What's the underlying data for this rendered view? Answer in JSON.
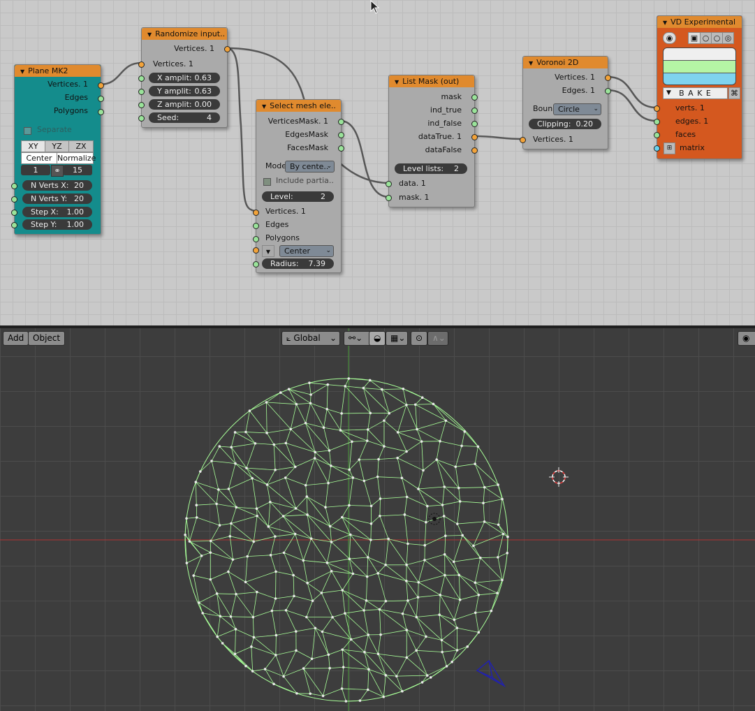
{
  "nodes": {
    "plane": {
      "title": "Plane MK2",
      "outputs": [
        "Vertices. 1",
        "Edges",
        "Polygons"
      ],
      "separate": "Separate",
      "planes": [
        "XY",
        "YZ",
        "ZX"
      ],
      "center": "Center",
      "normalize": "Normalize",
      "num_left": "1",
      "num_right": "15",
      "fields": [
        {
          "label": "N Verts X:",
          "value": "20"
        },
        {
          "label": "N Verts Y:",
          "value": "20"
        },
        {
          "label": "Step X:",
          "value": "1.00"
        },
        {
          "label": "Step Y:",
          "value": "1.00"
        }
      ]
    },
    "randomize": {
      "title": "Randomize input..",
      "output": "Vertices. 1",
      "input": "Vertices. 1",
      "fields": [
        {
          "label": "X amplit:",
          "value": "0.63"
        },
        {
          "label": "Y amplit:",
          "value": "0.63"
        },
        {
          "label": "Z amplit:",
          "value": "0.00"
        },
        {
          "label": "Seed:",
          "value": "4"
        }
      ]
    },
    "select": {
      "title": "Select mesh ele..",
      "outputs": [
        "VerticesMask. 1",
        "EdgesMask",
        "FacesMask"
      ],
      "mode_label": "Mode",
      "mode_value": "By cente..",
      "include": "Include partia..",
      "level": {
        "label": "Level:",
        "value": "2"
      },
      "inputs": [
        "Vertices. 1",
        "Edges",
        "Polygons"
      ],
      "center": "Center",
      "radius": {
        "label": "Radius:",
        "value": "7.39"
      }
    },
    "listmask": {
      "title": "List Mask (out)",
      "outputs": [
        "mask",
        "ind_true",
        "ind_false",
        "dataTrue. 1",
        "dataFalse"
      ],
      "level": {
        "label": "Level lists:",
        "value": "2"
      },
      "inputs": [
        "data. 1",
        "mask. 1"
      ]
    },
    "voronoi": {
      "title": "Voronoi 2D",
      "outputs": [
        "Vertices. 1",
        "Edges. 1"
      ],
      "bound_label": "Boun",
      "bound_value": "Circle",
      "clipping": {
        "label": "Clipping:",
        "value": "0.20"
      },
      "input": "Vertices. 1"
    },
    "viewer": {
      "title": "VD Experimental",
      "bake": "B A K E",
      "inputs": [
        "verts. 1",
        "edges. 1",
        "faces",
        "matrix"
      ],
      "colors": [
        "#efefef",
        "#b5f5a5",
        "#7fd3ee"
      ]
    }
  },
  "viewport": {
    "add_label": "Add",
    "object_label": "Object",
    "orientation": "Global"
  },
  "colors": {
    "node_header": "#e08a2e",
    "plane_body": "#148c8c",
    "viewer_body": "#d4581f",
    "wire": "#444444",
    "mesh": "#a8ff98"
  }
}
